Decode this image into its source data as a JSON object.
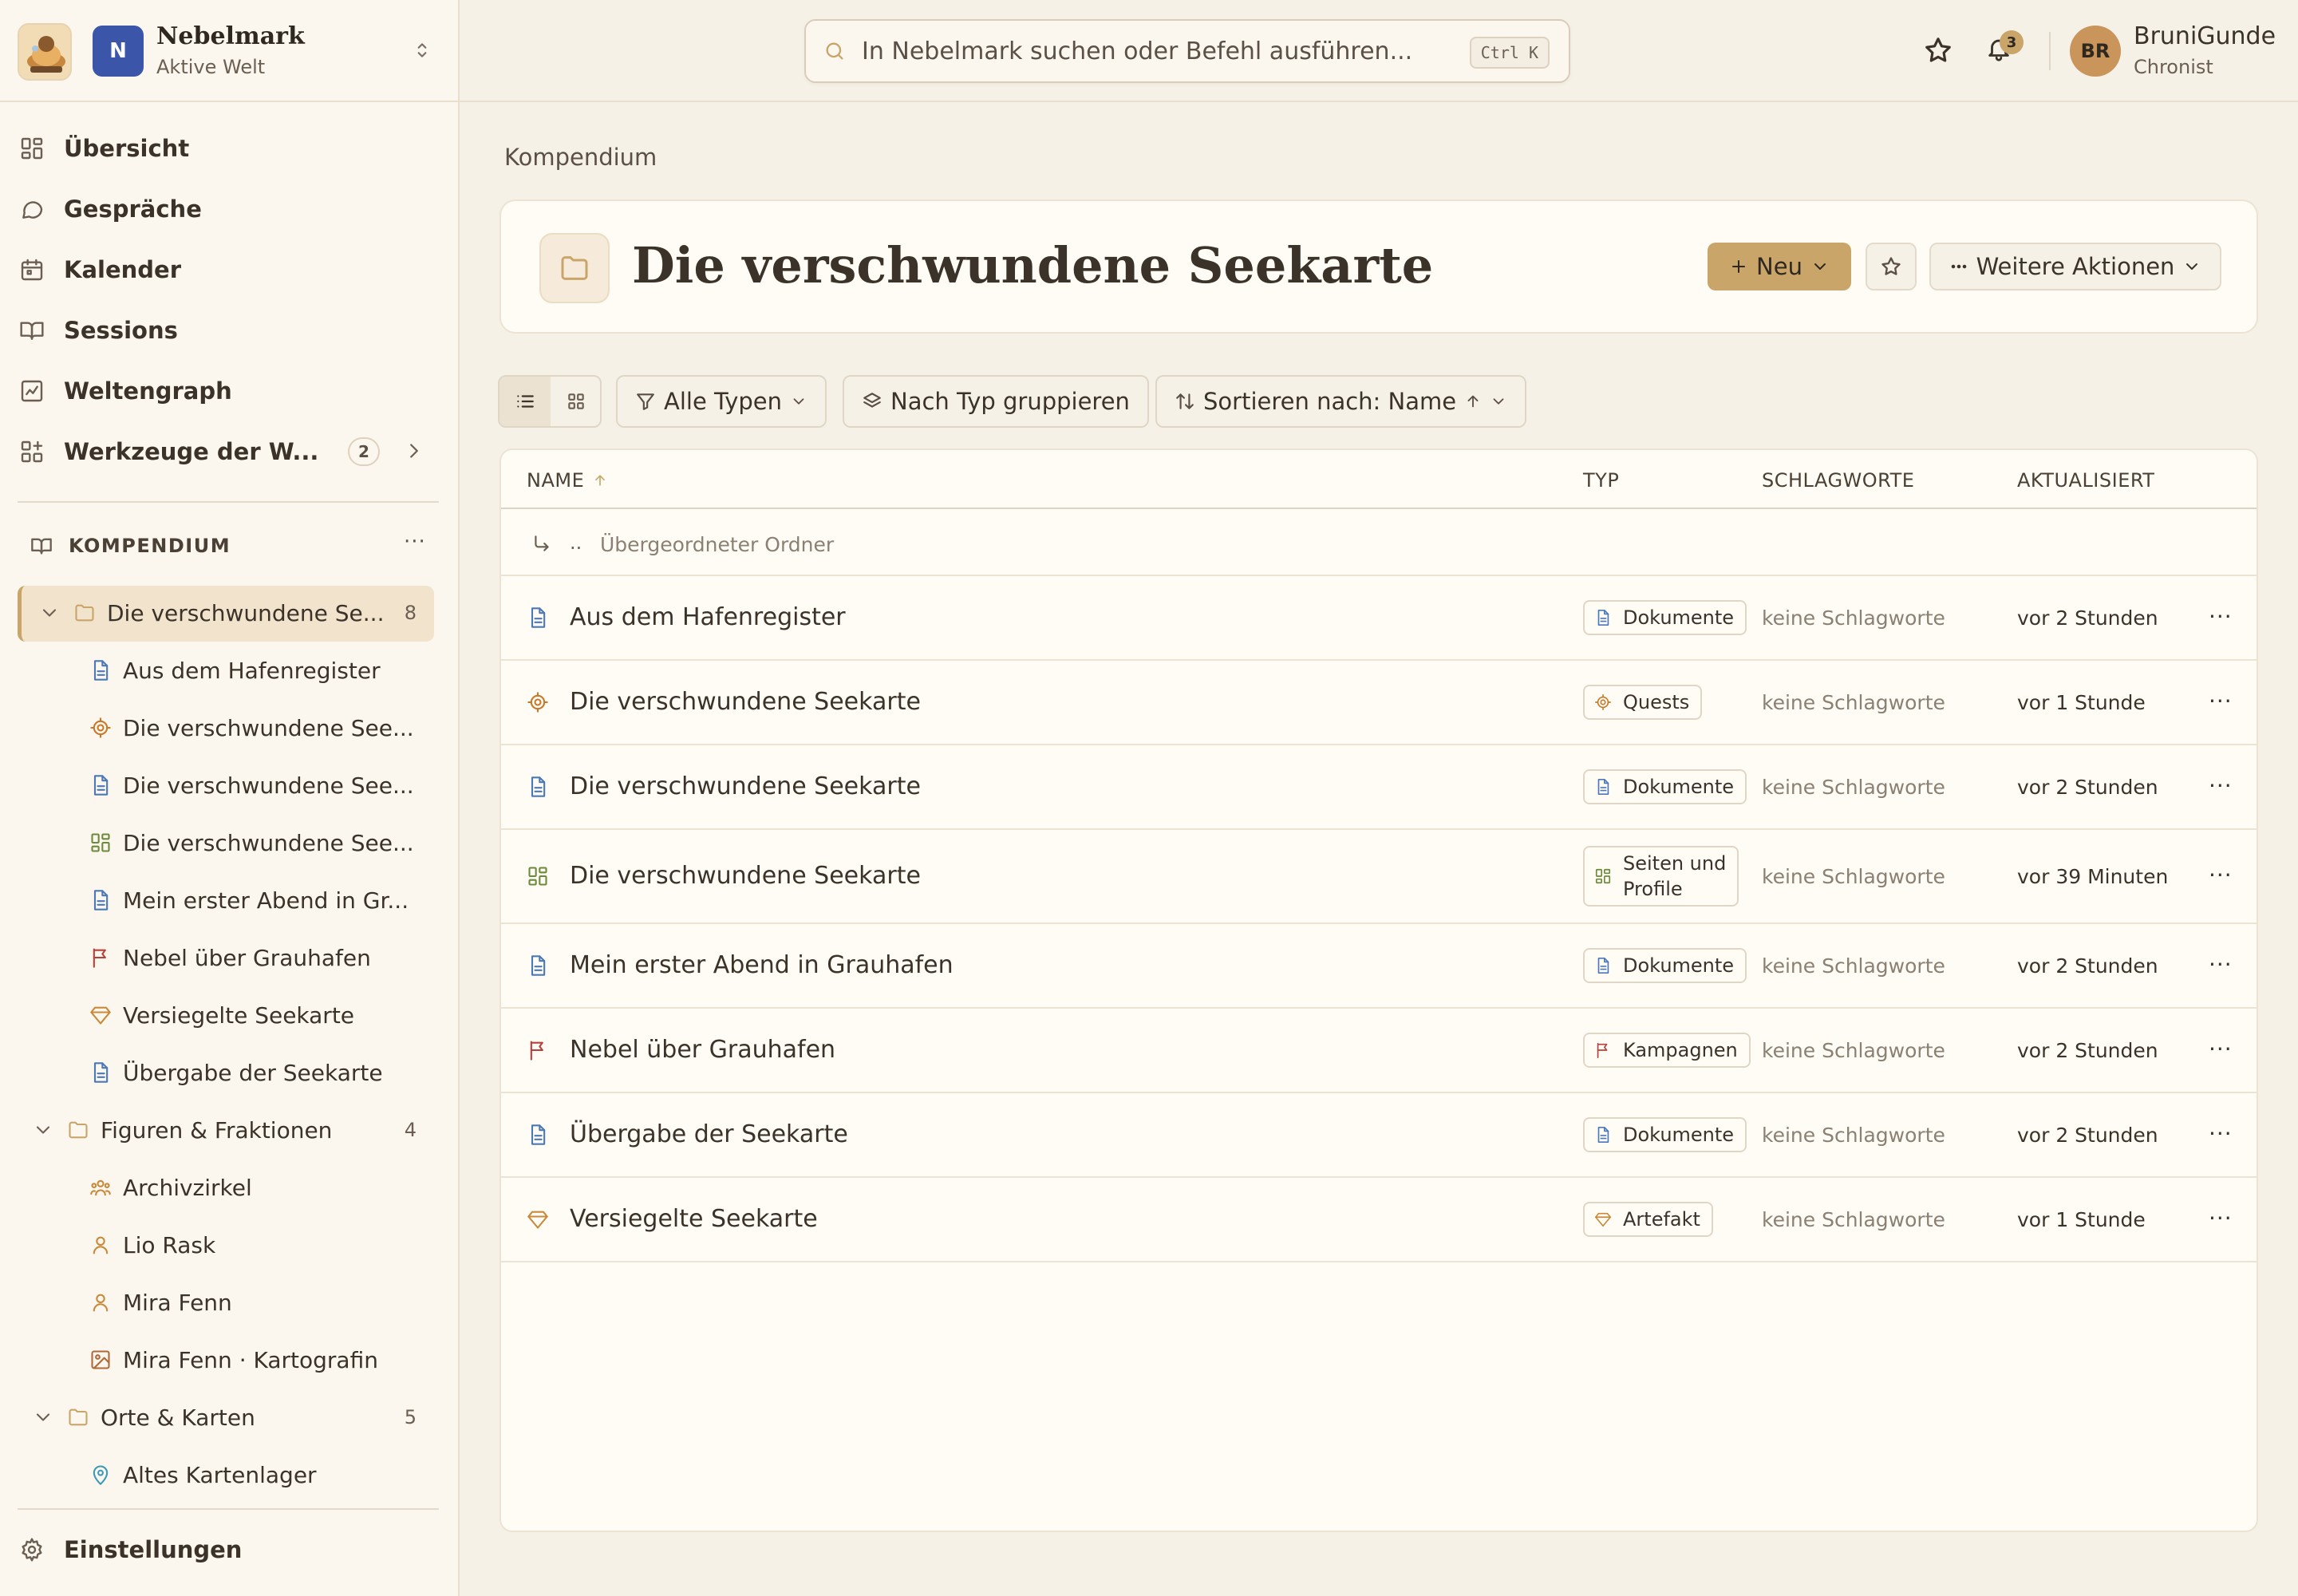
{
  "workspace": {
    "badge": "N",
    "name": "Nebelmark",
    "subtitle": "Aktive Welt"
  },
  "nav": [
    {
      "label": "Übersicht",
      "icon": "dashboard-icon"
    },
    {
      "label": "Gespräche",
      "icon": "chat-bubble-icon"
    },
    {
      "label": "Kalender",
      "icon": "calendar-icon"
    },
    {
      "label": "Sessions",
      "icon": "book-open-icon"
    },
    {
      "label": "Weltengraph",
      "icon": "line-chart-icon"
    },
    {
      "label": "Werkzeuge der W...",
      "icon": "tools-grid-icon",
      "badge": "2"
    }
  ],
  "compendium": {
    "title": "KOMPENDIUM",
    "more": "···"
  },
  "tree": {
    "folder1": {
      "label": "Die verschwundene Se...",
      "count": "8"
    },
    "folder1_items": [
      {
        "label": "Aus dem Hafenregister",
        "icon": "document-icon"
      },
      {
        "label": "Die verschwundene See...",
        "icon": "target-icon"
      },
      {
        "label": "Die verschwundene See...",
        "icon": "document-icon"
      },
      {
        "label": "Die verschwundene See...",
        "icon": "grid-page-icon"
      },
      {
        "label": "Mein erster Abend in Gr...",
        "icon": "document-icon"
      },
      {
        "label": "Nebel über Grauhafen",
        "icon": "flag-icon"
      },
      {
        "label": "Versiegelte Seekarte",
        "icon": "gem-icon"
      },
      {
        "label": "Übergabe der Seekarte",
        "icon": "document-icon"
      }
    ],
    "folder2": {
      "label": "Figuren & Fraktionen",
      "count": "4"
    },
    "folder2_items": [
      {
        "label": "Archivzirkel",
        "icon": "group-icon"
      },
      {
        "label": "Lio Rask",
        "icon": "person-icon"
      },
      {
        "label": "Mira Fenn",
        "icon": "person-icon"
      },
      {
        "label": "Mira Fenn · Kartografin",
        "icon": "image-icon"
      }
    ],
    "folder3": {
      "label": "Orte & Karten",
      "count": "5"
    },
    "folder3_items": [
      {
        "label": "Altes Kartenlager",
        "icon": "location-pin-icon"
      }
    ]
  },
  "settings": {
    "label": "Einstellungen"
  },
  "search": {
    "placeholder": "In Nebelmark suchen oder Befehl ausführen...",
    "shortcut": "Ctrl K"
  },
  "notifications": {
    "count": "3"
  },
  "user": {
    "initials": "BR",
    "name": "BruniGunde",
    "role": "Chronist"
  },
  "breadcrumb": "Kompendium",
  "page": {
    "title": "Die verschwundene Seekarte"
  },
  "actions": {
    "new_label": "Neu",
    "more_label": "Weitere Aktionen"
  },
  "toolbar": {
    "filter_label": "Alle Typen",
    "group_label": "Nach Typ gruppieren",
    "sort_label": "Sortieren nach: Name"
  },
  "table": {
    "headers": {
      "name": "NAME",
      "type": "TYP",
      "tags": "SCHLAGWORTE",
      "updated": "AKTUALISIERT"
    },
    "parent": {
      "dots": "..",
      "label": "Übergeordneter Ordner"
    },
    "rows": [
      {
        "name": "Aus dem Hafenregister",
        "icon": "document-icon",
        "type": "Dokumente",
        "tags": "keine Schlagworte",
        "updated": "vor 2 Stunden"
      },
      {
        "name": "Die verschwundene Seekarte",
        "icon": "target-icon",
        "type": "Quests",
        "tags": "keine Schlagworte",
        "updated": "vor 1 Stunde"
      },
      {
        "name": "Die verschwundene Seekarte",
        "icon": "document-icon",
        "type": "Dokumente",
        "tags": "keine Schlagworte",
        "updated": "vor 2 Stunden"
      },
      {
        "name": "Die verschwundene Seekarte",
        "icon": "grid-page-icon",
        "type_line1": "Seiten und",
        "type_line2": "Profile",
        "tags": "keine Schlagworte",
        "updated": "vor 39 Minuten"
      },
      {
        "name": "Mein erster Abend in Grauhafen",
        "icon": "document-icon",
        "type": "Dokumente",
        "tags": "keine Schlagworte",
        "updated": "vor 2 Stunden"
      },
      {
        "name": "Nebel über Grauhafen",
        "icon": "flag-icon",
        "type": "Kampagnen",
        "tags": "keine Schlagworte",
        "updated": "vor 2 Stunden"
      },
      {
        "name": "Übergabe der Seekarte",
        "icon": "document-icon",
        "type": "Dokumente",
        "tags": "keine Schlagworte",
        "updated": "vor 2 Stunden"
      },
      {
        "name": "Versiegelte Seekarte",
        "icon": "gem-icon",
        "type": "Artefakt",
        "tags": "keine Schlagworte",
        "updated": "vor 1 Stunde"
      }
    ],
    "row_more": "···"
  }
}
